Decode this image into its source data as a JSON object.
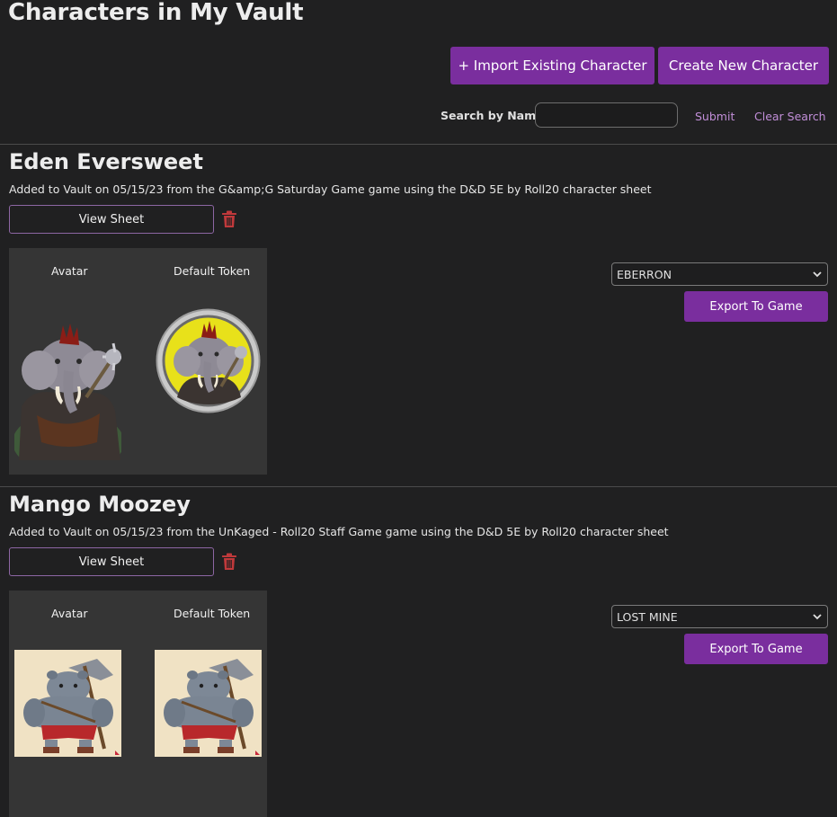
{
  "header": {
    "title": "Characters in My Vault",
    "import_label": "+ Import Existing Character",
    "create_label": "Create New Character",
    "search_label": "Search by Name:",
    "search_value": "",
    "submit_label": "Submit",
    "clear_label": "Clear Search"
  },
  "characters": [
    {
      "name": "Eden Eversweet",
      "meta": "Added to Vault on 05/15/23 from the G&amp;G Saturday Game game using the D&D 5E by Roll20 character sheet",
      "view_label": "View Sheet",
      "avatar_label": "Avatar",
      "token_label": "Default Token",
      "game_select": "EBERRON",
      "export_label": "Export To Game"
    },
    {
      "name": "Mango Moozey",
      "meta": "Added to Vault on 05/15/23 from the UnKaged - Roll20 Staff Game game using the D&D 5E by Roll20 character sheet",
      "view_label": "View Sheet",
      "avatar_label": "Avatar",
      "token_label": "Default Token",
      "game_select": "LOST MINE",
      "export_label": "Export To Game"
    }
  ],
  "colors": {
    "accent": "#7a2e9e",
    "background": "#202021",
    "panel": "#353535",
    "link": "#c18ed8",
    "trash": "#c0393b"
  },
  "icons": [
    "trash-icon",
    "chevron-down-icon"
  ]
}
